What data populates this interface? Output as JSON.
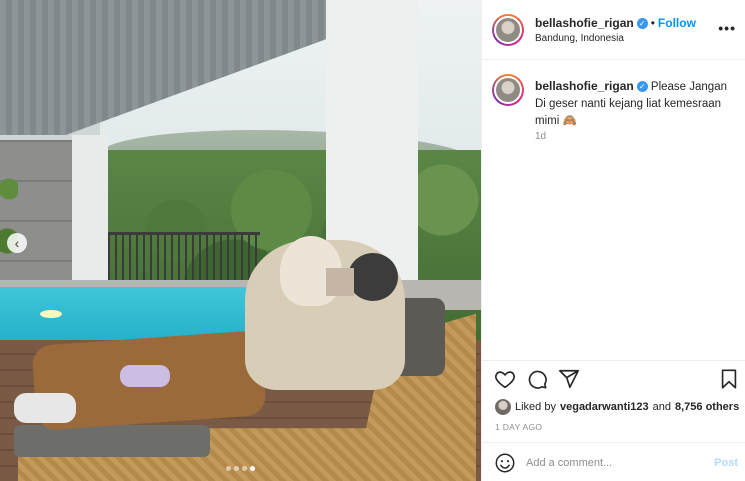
{
  "post": {
    "username": "bellashofie_rigan",
    "follow_label": "Follow",
    "bullet": "•",
    "location": "Bandung, Indonesia",
    "more_label": "•••"
  },
  "caption": {
    "username": "bellashofie_rigan",
    "text": "Please Jangan Di geser nanti kejang liat kemesraan mimi 🙈",
    "time": "1d"
  },
  "likes": {
    "prefix": "Liked by",
    "user": "vegadarwanti123",
    "conjunction": "and",
    "others": "8,756 others"
  },
  "posted_time": "1 DAY AGO",
  "comment": {
    "placeholder": "Add a comment...",
    "post_label": "Post"
  },
  "carousel": {
    "prev_label": "‹",
    "count": 4,
    "active_index": 3
  },
  "colors": {
    "link_blue": "#0095f6",
    "verified_blue": "#3897f0",
    "muted": "#8e8e8e",
    "post_disabled": "#b3dbff"
  },
  "icons": {
    "like": "heart-icon",
    "comment": "comment-icon",
    "share": "share-icon",
    "save": "bookmark-icon",
    "emoji": "smiley-icon",
    "verified": "verified-badge-icon",
    "more": "more-options-icon"
  }
}
